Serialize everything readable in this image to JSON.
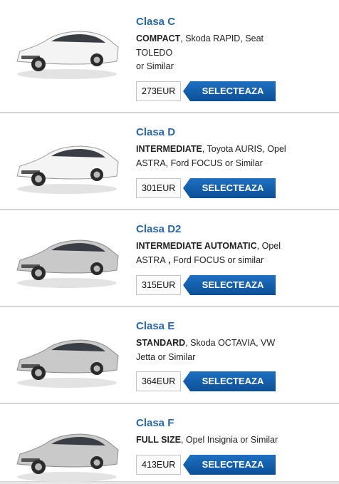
{
  "cars": [
    {
      "class": "Clasa C",
      "category": "COMPACT",
      "models_line1": ", Skoda RAPID, Seat",
      "models_line2": "TOLEDO",
      "models_line3": "or Similar",
      "price": "273EUR",
      "button": "SELECTEAZA",
      "color": "#f4f4f4"
    },
    {
      "class": "Clasa D",
      "category": "INTERMEDIATE",
      "models_line1": ", Toyota AURIS, Opel",
      "models_line2": "ASTRA, Ford FOCUS or Similar",
      "price": "301EUR",
      "button": "SELECTEAZA",
      "color": "#f4f4f4"
    },
    {
      "class": "Clasa D2",
      "category": "INTERMEDIATE AUTOMATIC",
      "models_line1": ", Opel",
      "models_line2a": "ASTRA",
      "models_line2b": " , ",
      "models_line2c": "Ford FOCUS  or similar",
      "price": "315EUR",
      "button": "SELECTEAZA",
      "color": "#c9c9c9"
    },
    {
      "class": "Clasa E",
      "category": "STANDARD",
      "models_line1": ", Skoda OCTAVIA, VW",
      "models_line2": "Jetta or Similar",
      "price": "364EUR",
      "button": "SELECTEAZA",
      "color": "#c9c9c9"
    },
    {
      "class": "Clasa F",
      "category": "FULL SIZE",
      "models_line1": ", Opel Insignia or Similar",
      "price": "413EUR",
      "button": "SELECTEAZA",
      "color": "#c9c9c9"
    }
  ]
}
